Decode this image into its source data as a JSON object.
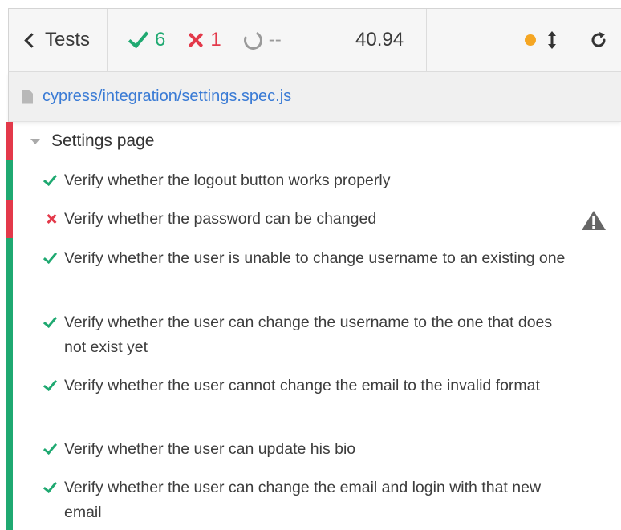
{
  "header": {
    "tests_label": "Tests",
    "passed": "6",
    "failed": "1",
    "pending": "--",
    "duration": "40.94"
  },
  "spec": {
    "path": "cypress/integration/settings.spec.js"
  },
  "suite": {
    "title": "Settings page",
    "tests": [
      {
        "title": "Verify whether the logout button works properly",
        "state": "passed"
      },
      {
        "title": "Verify whether the password can be changed",
        "state": "failed"
      },
      {
        "title": "Verify whether the user is unable to change username to an existing one",
        "state": "passed"
      },
      {
        "title": "Verify whether the user can change the username to the one that does not exist yet",
        "state": "passed"
      },
      {
        "title": "Verify whether the user cannot change the email to the invalid format",
        "state": "passed"
      },
      {
        "title": "Verify whether the user can update his bio",
        "state": "passed"
      },
      {
        "title": "Verify whether the user can change the email and login with that new email",
        "state": "passed"
      }
    ]
  },
  "colors": {
    "passed": "#1fa971",
    "failed": "#e3394a",
    "running": "#f5a623",
    "link": "#3a7bd5"
  },
  "icons": {
    "back": "chevron-left-icon",
    "pass": "check-icon",
    "fail": "x-icon",
    "pending": "spinner-icon",
    "status": "dot-icon",
    "scroll": "up-down-arrow-icon",
    "rerun": "reload-icon",
    "file": "file-icon",
    "warning": "warning-icon"
  }
}
